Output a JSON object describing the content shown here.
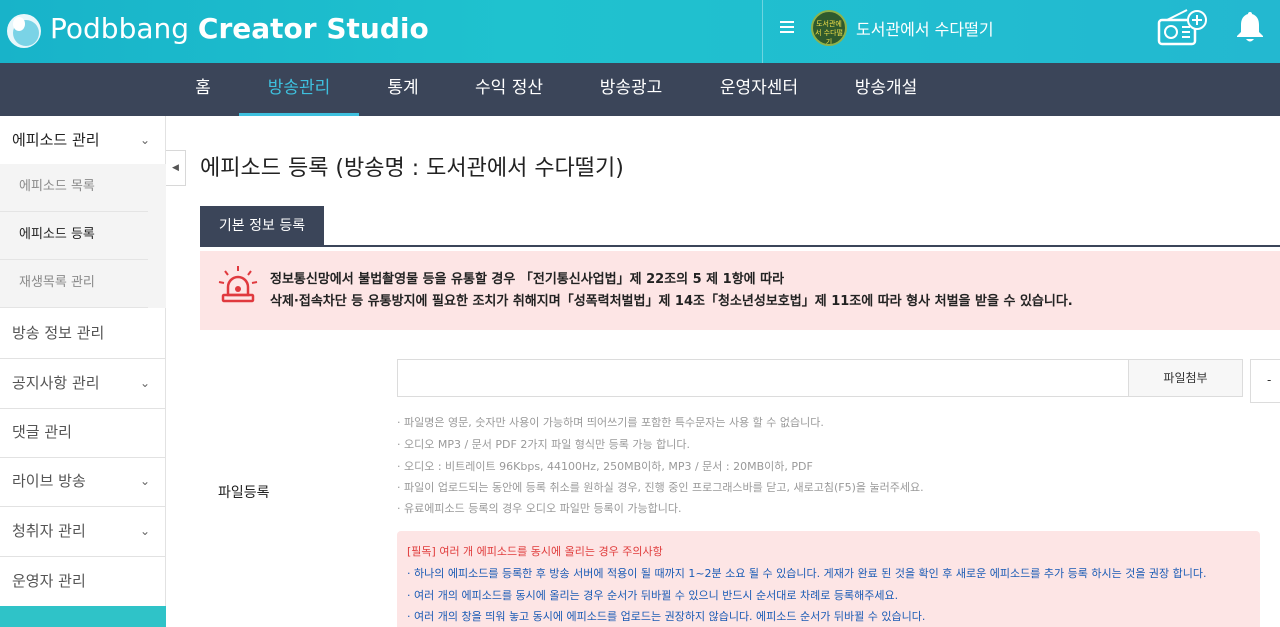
{
  "header": {
    "logo_regular": "Podbbang ",
    "logo_bold": "Creator Studio",
    "channel_avatar_text": "도서관에서 수다떨기",
    "channel_name": "도서관에서 수다떨기",
    "icons": [
      "logo-drop-icon",
      "menu-icon",
      "radio-add-icon",
      "bell-icon"
    ]
  },
  "nav": {
    "items": [
      "홈",
      "방송관리",
      "통계",
      "수익 정산",
      "방송광고",
      "운영자센터",
      "방송개설"
    ],
    "active_index": 1,
    "active_color": "#3ec0de"
  },
  "sidebar": {
    "episode_mgmt": "에피소드 관리",
    "sub_items": [
      "에피소드 목록",
      "에피소드 등록",
      "재생목록 관리"
    ],
    "active_sub_index": 1,
    "items": [
      "방송 정보 관리",
      "공지사항 관리",
      "댓글 관리",
      "라이브 방송",
      "청취자 관리",
      "운영자 관리"
    ],
    "chevron": "⌄",
    "collapse_arrow": "◀"
  },
  "main": {
    "title": "에피소드 등록 (방송명 : 도서관에서 수다떨기)",
    "tab_basic": "기본 정보 등록",
    "warning_lines": [
      "정보통신망에서 불법촬영물 등을 유통할 경우 「전기통신사업법」제 22조의 5 제 1항에 따라",
      "삭제·접속차단 등 유통방지에 필요한 조치가 취해지며「성폭력처벌법」제 14조「청소년성보호법」제 11조에 따라 형사 처벌을 받을 수 있습니다."
    ],
    "file_label": "파일등록",
    "file_input_value": "",
    "attach_button": "파일첨부",
    "minus_button": "-",
    "hints": [
      "· 파일명은 영문, 숫자만 사용이 가능하며 띄어쓰기를 포함한 특수문자는 사용 할 수 없습니다.",
      "· 오디오 MP3 / 문서 PDF 2가지 파일 형식만 등록 가능 합니다.",
      "· 오디오 : 비트레이트 96Kbps, 44100Hz, 250MB이하, MP3 / 문서 : 20MB이하, PDF",
      "· 파일이 업로드되는 동안에 등록 취소를 원하실 경우, 진행 중인 프로그래스바를 닫고, 새로고침(F5)을 눌러주세요.",
      "· 유료에피소드 등록의 경우 오디오 파일만 등록이 가능합니다."
    ],
    "caution_title": "[필독] 여러 개 에피소드를 동시에 올리는 경우 주의사항",
    "caution_lines": [
      "· 하나의 에피소드를 등록한 후 방송 서버에 적용이 될 때까지 1~2분 소요 될 수 있습니다. 게재가 완료 된 것을 확인 후 새로운 에피소드를 추가 등록 하시는 것을 권장 합니다.",
      "· 여러 개의 에피소드를 동시에 올리는 경우 순서가 뒤바뀔 수 있으니 반드시 순서대로 차례로 등록해주세요.",
      "· 여러 개의 창을 띄워 놓고 동시에 에피소드를 업로드는 권장하지 않습니다. 에피소드 순서가 뒤바뀔 수 있습니다."
    ],
    "colors": {
      "warning_bg": "#fde5e5",
      "caution_title": "#e03c3c",
      "caution_text": "#1a5bb5",
      "nav_bg": "#3b4559"
    }
  }
}
